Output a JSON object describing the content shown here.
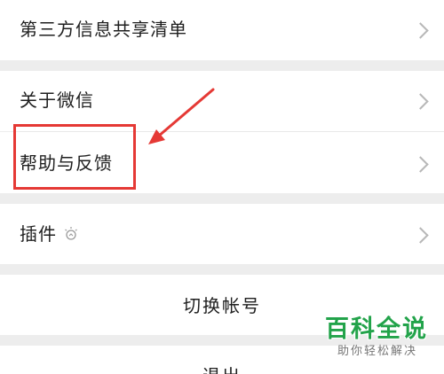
{
  "menu": {
    "items": [
      {
        "label": "第三方信息共享清单"
      },
      {
        "label": "关于微信"
      },
      {
        "label": "帮助与反馈"
      },
      {
        "label": "插件"
      }
    ]
  },
  "actions": {
    "switch_account": "切换帐号",
    "logout": "退出"
  },
  "watermark": {
    "title": "百科全说",
    "subtitle": "助你轻松解决"
  },
  "icons": {
    "chevron": "chevron-right-icon",
    "plugin": "lightbulb-icon"
  },
  "colors": {
    "background": "#ededed",
    "highlight": "#e53935",
    "watermark": "#22a34a"
  }
}
